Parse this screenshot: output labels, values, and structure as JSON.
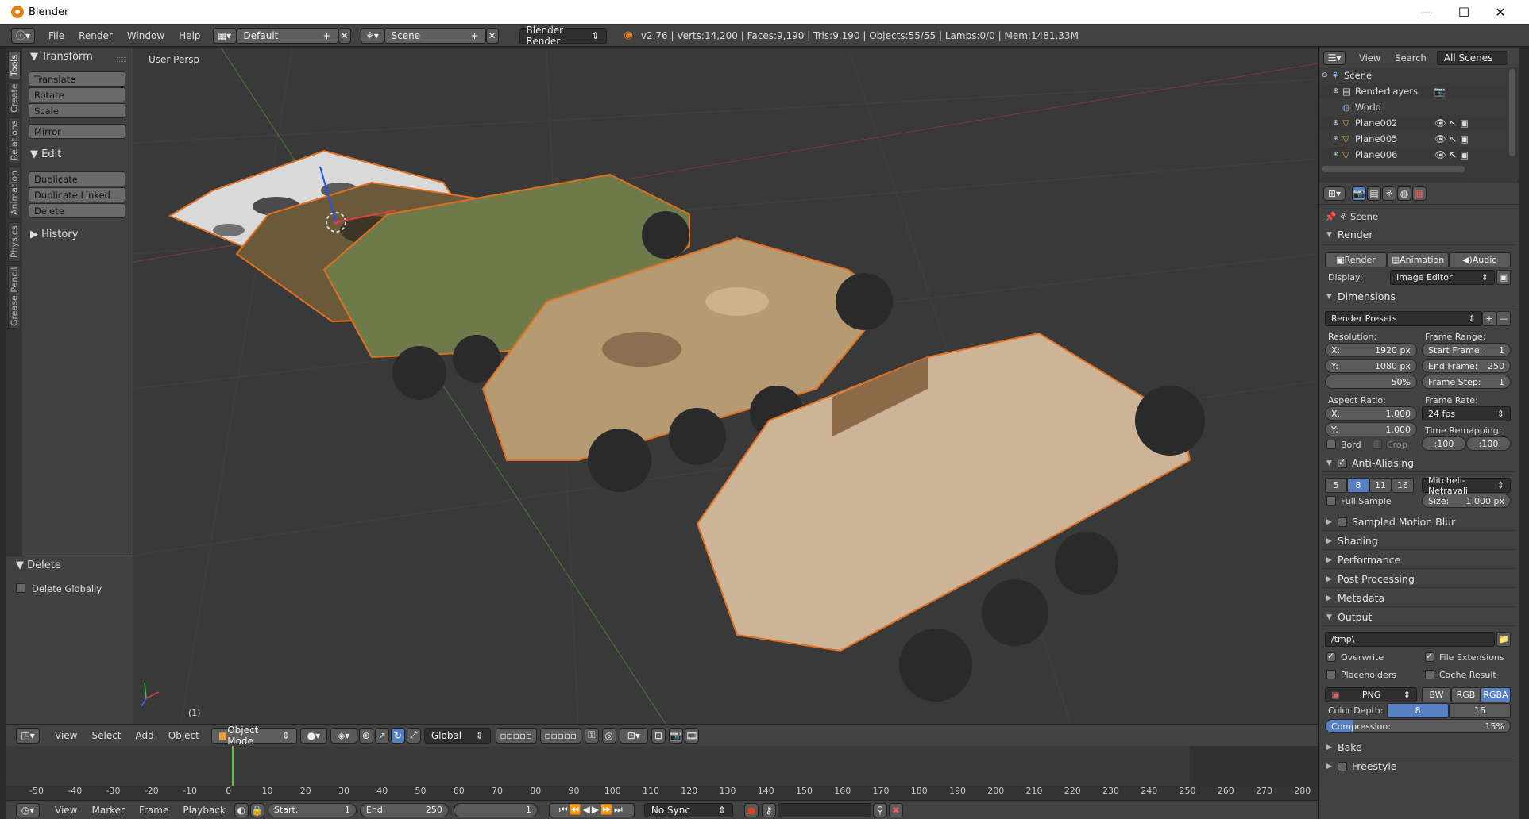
{
  "window": {
    "title": "Blender",
    "controls": {
      "minimize": "—",
      "maximize": "☐",
      "close": "✕"
    }
  },
  "infobar": {
    "menus": [
      "File",
      "Render",
      "Window",
      "Help"
    ],
    "layout": "Default",
    "scene": "Scene",
    "engine": "Blender Render",
    "stats": "v2.76 | Verts:14,200 | Faces:9,190 | Tris:9,190 | Objects:55/55 | Lamps:0/0 | Mem:1481.33M"
  },
  "left_tabs": [
    "Tools",
    "Create",
    "Relations",
    "Animation",
    "Physics",
    "Grease Pencil"
  ],
  "toolshelf": {
    "transform": {
      "title": "Transform",
      "buttons": [
        "Translate",
        "Rotate",
        "Scale"
      ],
      "mirror": "Mirror"
    },
    "edit": {
      "title": "Edit",
      "buttons": [
        "Duplicate",
        "Duplicate Linked",
        "Delete"
      ]
    },
    "history": {
      "title": "History"
    },
    "delete_panel": {
      "title": "Delete",
      "option": "Delete Globally",
      "checked": false
    }
  },
  "viewport": {
    "label": "User Persp",
    "frame_label": "(1)"
  },
  "view3d_header": {
    "menus": [
      "View",
      "Select",
      "Add",
      "Object"
    ],
    "mode": "Object Mode",
    "orientation": "Global"
  },
  "timeline": {
    "ticks": [
      "-50",
      "-40",
      "-30",
      "-20",
      "-10",
      "0",
      "10",
      "20",
      "30",
      "40",
      "50",
      "60",
      "70",
      "80",
      "90",
      "100",
      "110",
      "120",
      "130",
      "140",
      "150",
      "160",
      "170",
      "180",
      "190",
      "200",
      "210",
      "220",
      "230",
      "240",
      "250",
      "260",
      "270",
      "280"
    ],
    "current_frame": 1,
    "menus": [
      "View",
      "Marker",
      "Frame",
      "Playback"
    ],
    "start_label": "Start:",
    "start": "1",
    "end_label": "End:",
    "end": "250",
    "frame": "1",
    "sync": "No Sync"
  },
  "outliner": {
    "menus": [
      "View",
      "Search"
    ],
    "display": "All Scenes",
    "items": [
      {
        "name": "Scene",
        "icon": "scene-icon"
      },
      {
        "name": "RenderLayers",
        "icon": "renderlayers-icon"
      },
      {
        "name": "World",
        "icon": "world-icon"
      },
      {
        "name": "Plane002",
        "icon": "mesh-icon"
      },
      {
        "name": "Plane005",
        "icon": "mesh-icon"
      },
      {
        "name": "Plane006",
        "icon": "mesh-icon"
      }
    ]
  },
  "properties": {
    "context": "Scene",
    "render": {
      "title": "Render",
      "buttons": [
        "Render",
        "Animation",
        "Audio"
      ],
      "display_label": "Display:",
      "display": "Image Editor"
    },
    "dimensions": {
      "title": "Dimensions",
      "presets": "Render Presets",
      "resolution_label": "Resolution:",
      "res_x_label": "X:",
      "res_x": "1920 px",
      "res_y_label": "Y:",
      "res_y": "1080 px",
      "res_pct": "50%",
      "frame_range_label": "Frame Range:",
      "start_label": "Start Frame:",
      "start": "1",
      "end_label": "End Frame:",
      "end": "250",
      "step_label": "Frame Step:",
      "step": "1",
      "aspect_label": "Aspect Ratio:",
      "asp_x_label": "X:",
      "asp_x": "1.000",
      "asp_y_label": "Y:",
      "asp_y": "1.000",
      "frame_rate_label": "Frame Rate:",
      "fps": "24 fps",
      "time_remap_label": "Time Remapping:",
      "remap_old": ":100",
      "remap_new": ":100",
      "bord": "Bord",
      "crop": "Crop"
    },
    "aa": {
      "title": "Anti-Aliasing",
      "samples": [
        "5",
        "8",
        "11",
        "16"
      ],
      "selected_sample": "8",
      "filter": "Mitchell-Netravali",
      "full_sample": "Full Sample",
      "size_label": "Size:",
      "size": "1.000 px"
    },
    "collapsed": [
      "Sampled Motion Blur",
      "Shading",
      "Performance",
      "Post Processing",
      "Metadata"
    ],
    "output": {
      "title": "Output",
      "path": "/tmp\\",
      "overwrite": "Overwrite",
      "file_extensions": "File Extensions",
      "placeholders": "Placeholders",
      "cache_result": "Cache Result",
      "format": "PNG",
      "channels": [
        "BW",
        "RGB",
        "RGBA"
      ],
      "selected_channel": "RGBA",
      "color_depth_label": "Color Depth:",
      "depths": [
        "8",
        "16"
      ],
      "selected_depth": "8",
      "compression_label": "Compression:",
      "compression": "15%"
    },
    "bake": "Bake",
    "freestyle": "Freestyle"
  },
  "colors": {
    "accent": "#5680c2",
    "selection_outline": "#e07020",
    "current_frame": "#60c040"
  }
}
